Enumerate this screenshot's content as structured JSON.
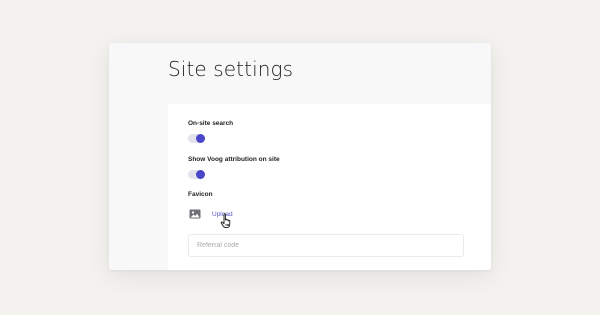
{
  "page": {
    "title": "Site settings"
  },
  "settings": {
    "onsite_search": {
      "label": "On-site search",
      "enabled": true
    },
    "voog_attribution": {
      "label": "Show Voog attribution on site",
      "enabled": true
    },
    "favicon": {
      "label": "Favicon",
      "upload_label": "Upload"
    },
    "referral": {
      "placeholder": "Referral code",
      "value": ""
    }
  },
  "icons": {
    "favicon_preview": "image-icon",
    "pointer": "hand-pointer-icon"
  },
  "colors": {
    "accent": "#4a46c9",
    "toggle_track": "#e3e3ec",
    "link": "#5b55c4"
  }
}
